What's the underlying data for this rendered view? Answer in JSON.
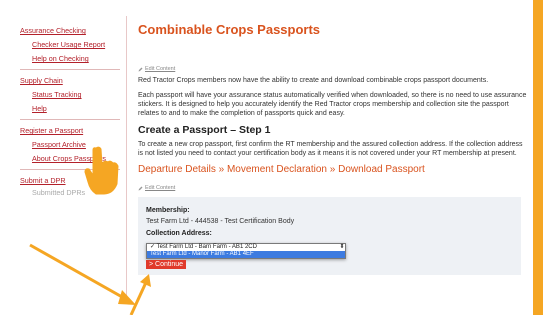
{
  "sidebar": {
    "items": [
      {
        "label": "Assurance Checking",
        "level": "head"
      },
      {
        "label": "Checker Usage Report",
        "level": "sub"
      },
      {
        "label": "Help on Checking",
        "level": "sub"
      },
      {
        "label": "Supply Chain",
        "level": "head"
      },
      {
        "label": "Status Tracking",
        "level": "sub"
      },
      {
        "label": "Help",
        "level": "sub"
      },
      {
        "label": "Register a Passport",
        "level": "head"
      },
      {
        "label": "Passport Archive",
        "level": "sub"
      },
      {
        "label": "About Crops Passports",
        "level": "sub"
      },
      {
        "label": "Submit a DPR",
        "level": "head"
      },
      {
        "label": "Submitted DPRs",
        "level": "sub"
      }
    ]
  },
  "main": {
    "title": "Combinable Crops Passports",
    "edit_content_label": "Edit Content",
    "intro_p1": "Red Tractor Crops members now have the ability to create and download combinable crops passport documents.",
    "intro_p2": "Each passport will have your assurance status automatically verified when downloaded, so there is no need to use assurance stickers. It is designed to help you accurately identify the Red Tractor crops membership and collection site the passport relates to and to make the completion of passports quick and easy.",
    "step_title": "Create a Passport – Step 1",
    "step_p": "To create a new crop passport, first confirm the RT membership and the assured collection address. If the collection address is not listed you need to contact your certification body as it means it is not covered under your RT membership at present.",
    "breadcrumb": {
      "step1": "Departure Details",
      "sep": "»",
      "step2": "Movement Declaration",
      "step3": "Download Passport"
    },
    "edit_content_label_2": "Edit Content",
    "form": {
      "membership_label": "Membership:",
      "membership_value": "Test Farm Ltd - 444538 - Test Certification Body",
      "collection_label": "Collection Address:",
      "options": [
        "✓ Test Farm Ltd - Barn Farm - AB1 2CD",
        "Test Farm Ltd - Manor Farm - AB1 4EF"
      ],
      "continue_label": "> Continue"
    }
  },
  "colors": {
    "accent_orange": "#f5a623",
    "title_orange": "#d9531e",
    "link_red": "#b3202a",
    "button_red": "#e03a2c",
    "highlight_blue": "#3d7be0"
  }
}
